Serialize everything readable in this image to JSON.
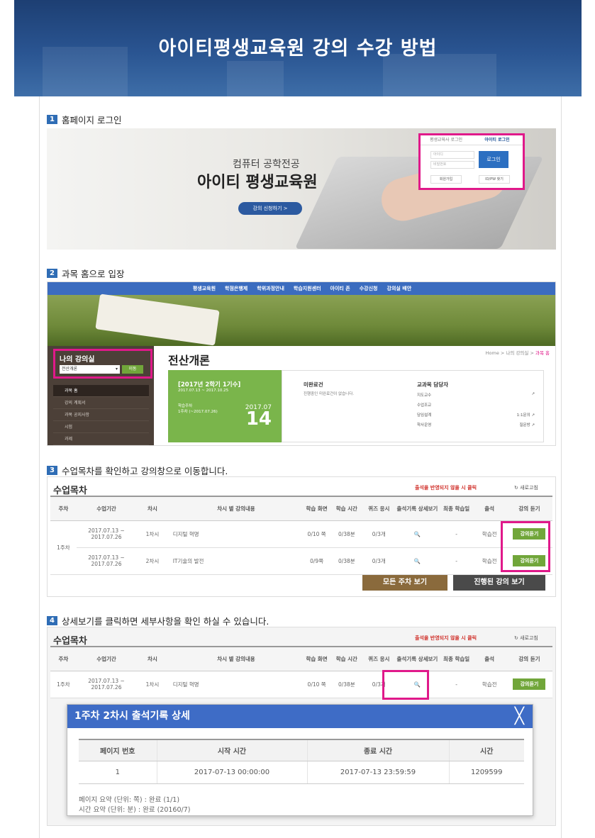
{
  "banner_title": "아이티평생교육원 강의 수강 방법",
  "steps": [
    {
      "num": "1",
      "text": "홈페이지 로그인"
    },
    {
      "num": "2",
      "text": "과목 홈으로 입장"
    },
    {
      "num": "3",
      "text": "수업목차를 확인하고 강의창으로 이동합니다."
    },
    {
      "num": "4",
      "text": "상세보기를 클릭하면 세부사항을 확인 하실 수 있습니다."
    }
  ],
  "home": {
    "subtitle": "컴퓨터 공학전공",
    "title": "아이티 평생교육원",
    "cta": "강의 신청하기 >",
    "login_tabs": [
      "평생교육사 로그인",
      "아이티 로그인"
    ],
    "id_placeholder": "아이디",
    "pw_placeholder": "비밀번호",
    "login_button": "로그인",
    "join": "회원가입",
    "find": "ID/PW 찾기"
  },
  "course": {
    "gnb": [
      "평생교육원",
      "학점은행제",
      "학위과정안내",
      "학습지원센터",
      "아이티 존",
      "수강신청",
      "강의실 배안"
    ],
    "my_lecture_title": "나의 강의실",
    "select_value": "전산개론",
    "go_button": "이동",
    "menu": [
      "과목 홈",
      "강의 계획서",
      "과목 공지사항",
      "시험",
      "과제"
    ],
    "title": "전산개론",
    "breadcrumb_prefix": "Home > 나의 강의실 > ",
    "breadcrumb_current": "과목 홈",
    "term": "[2017년 2학기 1기수]",
    "term_dates": "2017.07.13 ~ 2017.10.25",
    "week_label": "학습주차",
    "week_range": "1주차 (~2017.07.26)",
    "year_month": "2017.07",
    "day": "14",
    "pending_title": "미완료건",
    "pending_text": "진행중인 미완료건이 없습니다.",
    "staff_title": "교과목 담당자",
    "staff": [
      {
        "role": "지도교수",
        "value": "↗"
      },
      {
        "role": "수업조교",
        "value": ""
      },
      {
        "role": "담임설계",
        "value": "1:1문의 ↗"
      },
      {
        "role": "학사운영",
        "value": "질문방 ↗"
      }
    ]
  },
  "lecture_table": {
    "title": "수업목차",
    "notice": "출석을 반영되지 않을 시 클릭",
    "refresh": "↻ 새로고침",
    "headers": [
      "주차",
      "수업기간",
      "차시",
      "차시 별 강의내용",
      "학습 화면",
      "학습 시간",
      "퀴즈 응시",
      "출석기록 상세보기",
      "최종 학습일",
      "출석",
      "강의 듣기"
    ],
    "week": "1주차",
    "rows": [
      {
        "period": "2017.07.13 ~ 2017.07.26",
        "session": "1차시",
        "content": "디지털 혁명",
        "screen": "0/10 쪽",
        "time": "0/38분",
        "quiz": "0/3개",
        "detail": "🔍",
        "last": "-",
        "attend": "학습전",
        "play": "강의듣기"
      },
      {
        "period": "2017.07.13 ~ 2017.07.26",
        "session": "2차시",
        "content": "IT기술의 발전",
        "screen": "0/9쪽",
        "time": "0/38분",
        "quiz": "0/3개",
        "detail": "🔍",
        "last": "-",
        "attend": "학습전",
        "play": "강의듣기"
      }
    ],
    "all_weeks_button": "모든 주차 보기",
    "progress_button": "진행된 강의 보기"
  },
  "modal": {
    "title": "1주차 2차시 출석기록 상세",
    "close": "╳",
    "headers": [
      "페이지 번호",
      "시작 시간",
      "종료 시간",
      "시간"
    ],
    "rows": [
      {
        "page": "1",
        "start": "2017-07-13 00:00:00",
        "end": "2017-07-13 23:59:59",
        "seconds": "1209599"
      }
    ],
    "summary_page": "페이지 요약 (단위: 쪽) : 완료 (1/1)",
    "summary_time": "시간 요약 (단위: 분) : 완료 (20160/7)"
  },
  "colors": {
    "accent_pink": "#e0198a",
    "green_button": "#71a63a",
    "brand_blue": "#2f6db5"
  }
}
